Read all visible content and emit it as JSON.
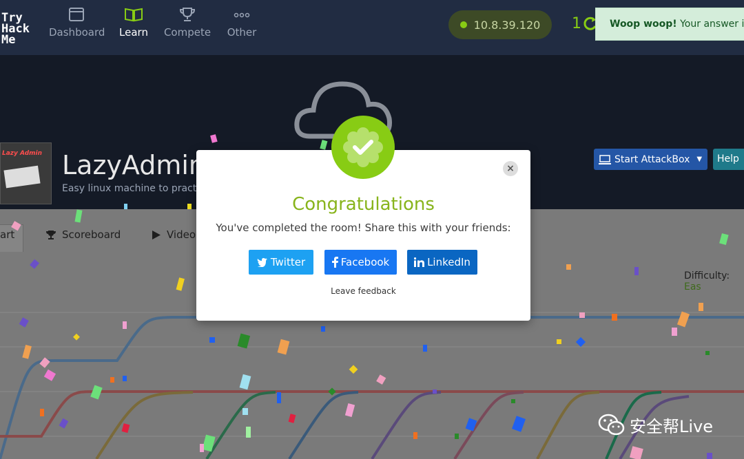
{
  "brand": {
    "logo_lines": [
      "Try",
      "Hack",
      "Me"
    ]
  },
  "nav": {
    "items": [
      {
        "label": "Dashboard",
        "icon": "dashboard-icon"
      },
      {
        "label": "Learn",
        "icon": "book-icon"
      },
      {
        "label": "Compete",
        "icon": "trophy-icon"
      },
      {
        "label": "Other",
        "icon": "more-icon"
      }
    ],
    "active": "Learn"
  },
  "header": {
    "ip_address": "10.8.39.120",
    "streak_count": "1",
    "toast_bold": "Woop woop!",
    "toast_text": "Your answer is"
  },
  "room": {
    "title": "LazyAdmin",
    "description": "Easy linux machine to practi",
    "image_title": "Lazy Admin",
    "start_attackbox": "Start AttackBox",
    "help": "Help"
  },
  "tabs": [
    {
      "label": "art",
      "icon": ""
    },
    {
      "label": "Scoreboard",
      "icon": "trophy-icon"
    },
    {
      "label": "Video",
      "icon": "play-icon"
    }
  ],
  "difficulty": {
    "label": "Difficulty:",
    "value": "Eas"
  },
  "modal": {
    "title": "Congratulations",
    "text": "You've completed the room! Share this with your friends:",
    "twitter": "Twitter",
    "facebook": "Facebook",
    "linkedin": "LinkedIn",
    "feedback": "Leave feedback",
    "close": "×"
  },
  "watermark": {
    "text": "安全帮Live"
  },
  "colors": {
    "accent_green": "#88cc14",
    "navbar_bg": "#212c42",
    "twitter": "#1da1f2",
    "facebook": "#1877f2",
    "linkedin": "#0a66c2",
    "attackbox": "#2456a6"
  }
}
